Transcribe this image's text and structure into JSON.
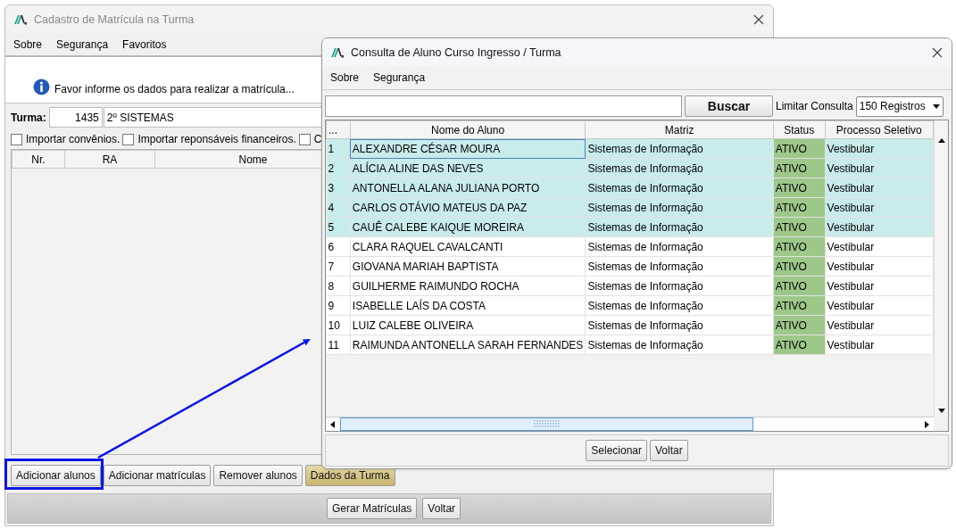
{
  "main_window": {
    "title": "Cadastro de Matrícula na Turma",
    "menu": [
      "Sobre",
      "Segurança",
      "Favoritos"
    ],
    "info_message": "Favor informe os dados para realizar a matrícula...",
    "turma": {
      "label": "Turma:",
      "code": "1435",
      "name": "2º SISTEMAS"
    },
    "options": [
      {
        "label": "Importar convênios.",
        "checked": false
      },
      {
        "label": "Importar reponsáveis financeiros.",
        "checked": false
      },
      {
        "label": "C",
        "checked": false
      }
    ],
    "table": {
      "columns": [
        "Nr.",
        "RA",
        "Nome"
      ]
    },
    "buttons": [
      {
        "label": "Adicionar alunos",
        "kind": "normal"
      },
      {
        "label": "Adicionar matrículas",
        "kind": "normal"
      },
      {
        "label": "Remover alunos",
        "kind": "normal"
      },
      {
        "label": "Dados da Turma",
        "kind": "accent"
      }
    ],
    "footer_buttons": [
      "Gerar Matrículas",
      "Voltar"
    ]
  },
  "dialog": {
    "title": "Consulta de Aluno Curso Ingresso / Turma",
    "menu": [
      "Sobre",
      "Segurança"
    ],
    "search_button": "Buscar",
    "limit_label": "Limitar Consulta",
    "limit_select": "150 Registros",
    "table": {
      "columns": [
        "...",
        "Nome do Aluno",
        "Matriz",
        "Status",
        "Processo Seletivo"
      ],
      "rows": [
        {
          "cells": [
            "1",
            "ALEXANDRE CÉSAR MOURA",
            "Sistemas de Informação",
            "ATIVO",
            "Vestibular"
          ],
          "selected": true
        },
        {
          "cells": [
            "2",
            "ALÍCIA ALINE DAS NEVES",
            "Sistemas de Informação",
            "ATIVO",
            "Vestibular"
          ],
          "selected": true
        },
        {
          "cells": [
            "3",
            "ANTONELLA ALANA JULIANA PORTO",
            "Sistemas de Informação",
            "ATIVO",
            "Vestibular"
          ],
          "selected": true
        },
        {
          "cells": [
            "4",
            "CARLOS OTÁVIO MATEUS DA PAZ",
            "Sistemas de Informação",
            "ATIVO",
            "Vestibular"
          ],
          "selected": true
        },
        {
          "cells": [
            "5",
            "CAUÊ CALEBE KAIQUE MOREIRA",
            "Sistemas de Informação",
            "ATIVO",
            "Vestibular"
          ],
          "selected": true
        },
        {
          "cells": [
            "6",
            "CLARA RAQUEL CAVALCANTI",
            "Sistemas de Informação",
            "ATIVO",
            "Vestibular"
          ],
          "selected": false
        },
        {
          "cells": [
            "7",
            "GIOVANA MARIAH BAPTISTA",
            "Sistemas de Informação",
            "ATIVO",
            "Vestibular"
          ],
          "selected": false
        },
        {
          "cells": [
            "8",
            "GUILHERME RAIMUNDO ROCHA",
            "Sistemas de Informação",
            "ATIVO",
            "Vestibular"
          ],
          "selected": false
        },
        {
          "cells": [
            "9",
            "ISABELLE LAÍS DA COSTA",
            "Sistemas de Informação",
            "ATIVO",
            "Vestibular"
          ],
          "selected": false
        },
        {
          "cells": [
            "10",
            "LUIZ CALEBE OLIVEIRA",
            "Sistemas de Informação",
            "ATIVO",
            "Vestibular"
          ],
          "selected": false
        },
        {
          "cells": [
            "11",
            "RAIMUNDA ANTONELLA SARAH FERNANDES",
            "Sistemas de Informação",
            "ATIVO",
            "Vestibular"
          ],
          "selected": false
        }
      ]
    },
    "buttons": [
      "Selecionar",
      "Voltar"
    ]
  }
}
